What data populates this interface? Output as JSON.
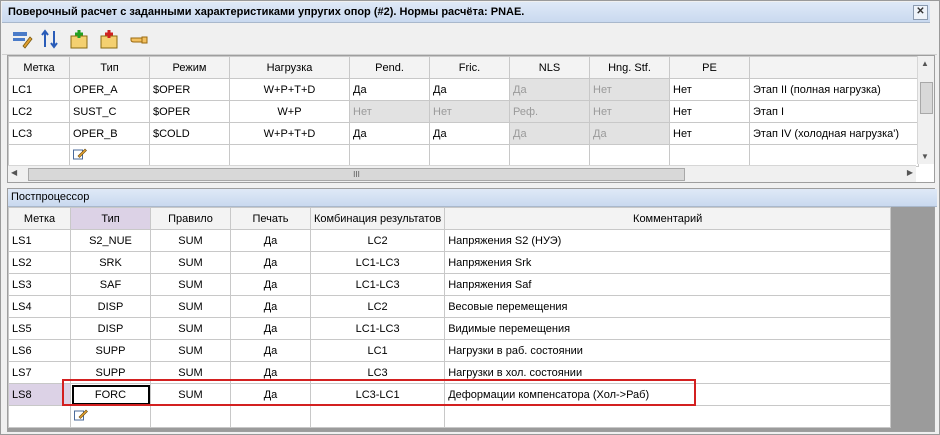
{
  "window": {
    "title": "Поверочный расчет с заданными характеристиками упругих опор (#2). Нормы расчёта: PNAE."
  },
  "toolbar": {
    "icons": [
      "edit-icon",
      "sort-icon",
      "insert-row-icon",
      "delete-row-icon",
      "pointer-hand-icon"
    ]
  },
  "loadcases": {
    "headers": [
      "Метка",
      "Тип",
      "Режим",
      "Нагрузка",
      "Pend.",
      "Fric.",
      "NLS",
      "Hng. Stf.",
      "PE",
      ""
    ],
    "rows": [
      {
        "label": "LC1",
        "type": "OPER_A",
        "mode": "$OPER",
        "load": "W+P+T+D",
        "pend": "Да",
        "fric": "Да",
        "nls": "Да",
        "hng": "Нет",
        "pe": "Нет",
        "comment": "Этап II (полная нагрузка)"
      },
      {
        "label": "LC2",
        "type": "SUST_C",
        "mode": "$OPER",
        "load": "W+P",
        "pend": "Нет",
        "fric": "Нет",
        "nls": "Реф.",
        "hng": "Нет",
        "pe": "Нет",
        "comment": "Этап I"
      },
      {
        "label": "LC3",
        "type": "OPER_B",
        "mode": "$COLD",
        "load": "W+P+T+D",
        "pend": "Да",
        "fric": "Да",
        "nls": "Да",
        "hng": "Да",
        "pe": "Нет",
        "comment": "Этап IV (холодная нагрузка')"
      }
    ]
  },
  "postprocessor": {
    "title": "Постпроцессор",
    "headers": [
      "Метка",
      "Тип",
      "Правило",
      "Печать",
      "Комбинация результатов",
      "Комментарий"
    ],
    "rows": [
      {
        "label": "LS1",
        "type": "S2_NUE",
        "rule": "SUM",
        "print": "Да",
        "combo": "LC2",
        "comment": "Напряжения S2 (НУЭ)"
      },
      {
        "label": "LS2",
        "type": "SRK",
        "rule": "SUM",
        "print": "Да",
        "combo": "LC1-LC3",
        "comment": "Напряжения Srk"
      },
      {
        "label": "LS3",
        "type": "SAF",
        "rule": "SUM",
        "print": "Да",
        "combo": "LC1-LC3",
        "comment": "Напряжения Saf"
      },
      {
        "label": "LS4",
        "type": "DISP",
        "rule": "SUM",
        "print": "Да",
        "combo": "LC2",
        "comment": "Весовые перемещения"
      },
      {
        "label": "LS5",
        "type": "DISP",
        "rule": "SUM",
        "print": "Да",
        "combo": "LC1-LC3",
        "comment": "Видимые перемещения"
      },
      {
        "label": "LS6",
        "type": "SUPP",
        "rule": "SUM",
        "print": "Да",
        "combo": "LC1",
        "comment": "Нагрузки в раб. состоянии"
      },
      {
        "label": "LS7",
        "type": "SUPP",
        "rule": "SUM",
        "print": "Да",
        "combo": "LC3",
        "comment": "Нагрузки в хол. состоянии"
      },
      {
        "label": "LS8",
        "type": "FORC",
        "rule": "SUM",
        "print": "Да",
        "combo": "LC3-LC1",
        "comment": "Деформации компенсатора (Хол->Раб)"
      }
    ]
  },
  "scroll": {
    "thumb_label": "III"
  }
}
